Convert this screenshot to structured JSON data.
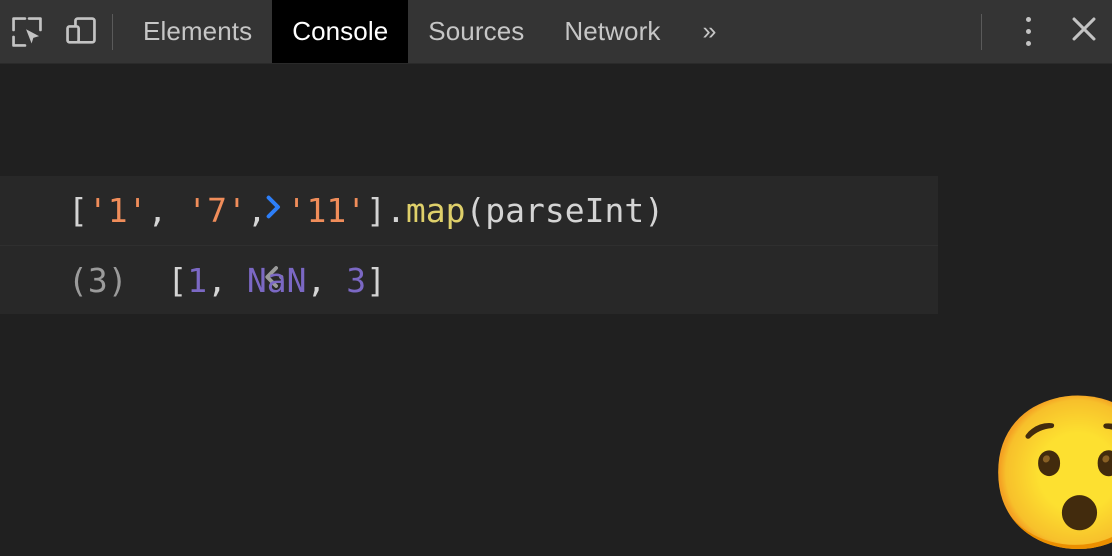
{
  "toolbar": {
    "inspect_icon": "inspect-element-icon",
    "device_icon": "device-toolbar-icon",
    "tabs": [
      {
        "label": "Elements",
        "active": false
      },
      {
        "label": "Console",
        "active": true
      },
      {
        "label": "Sources",
        "active": false
      },
      {
        "label": "Network",
        "active": false
      }
    ],
    "more_tabs_label": "»",
    "more_tabs_icon": "chevron-double-right-icon",
    "settings_icon": "kebab-menu-icon",
    "close_icon": "close-icon"
  },
  "console": {
    "input": {
      "prompt": ">",
      "prompt_icon": "chevron-right-icon",
      "expression": "['1', '7', '11'].map(parseInt)",
      "tokens": [
        {
          "text": "[",
          "type": "punct"
        },
        {
          "text": "'1'",
          "type": "string"
        },
        {
          "text": ", ",
          "type": "punct"
        },
        {
          "text": "'7'",
          "type": "string"
        },
        {
          "text": ", ",
          "type": "punct"
        },
        {
          "text": "'11'",
          "type": "string"
        },
        {
          "text": "].",
          "type": "punct"
        },
        {
          "text": "map",
          "type": "method"
        },
        {
          "text": "(parseInt)",
          "type": "ident"
        }
      ]
    },
    "output": {
      "return_icon": "return-value-arrow-icon",
      "length_label": "(3)",
      "value": "[1, NaN, 3]",
      "tokens": [
        {
          "text": "[",
          "type": "punct"
        },
        {
          "text": "1",
          "type": "number"
        },
        {
          "text": ", ",
          "type": "punct"
        },
        {
          "text": "NaN",
          "type": "nan"
        },
        {
          "text": ", ",
          "type": "punct"
        },
        {
          "text": "3",
          "type": "number"
        },
        {
          "text": "]",
          "type": "punct"
        }
      ]
    },
    "emoji": "😯",
    "emoji_name": "astonished-face-emoji"
  },
  "colors": {
    "toolbar_bg": "#343434",
    "panel_bg": "#202020",
    "message_bg": "#282828",
    "active_tab_bg": "#000000",
    "prompt_blue": "#2d7ff9",
    "string_orange": "#f08d5a",
    "method_yellow": "#dfd06a",
    "number_purple": "#7b68c4",
    "text_gray": "#d4d4d4"
  }
}
